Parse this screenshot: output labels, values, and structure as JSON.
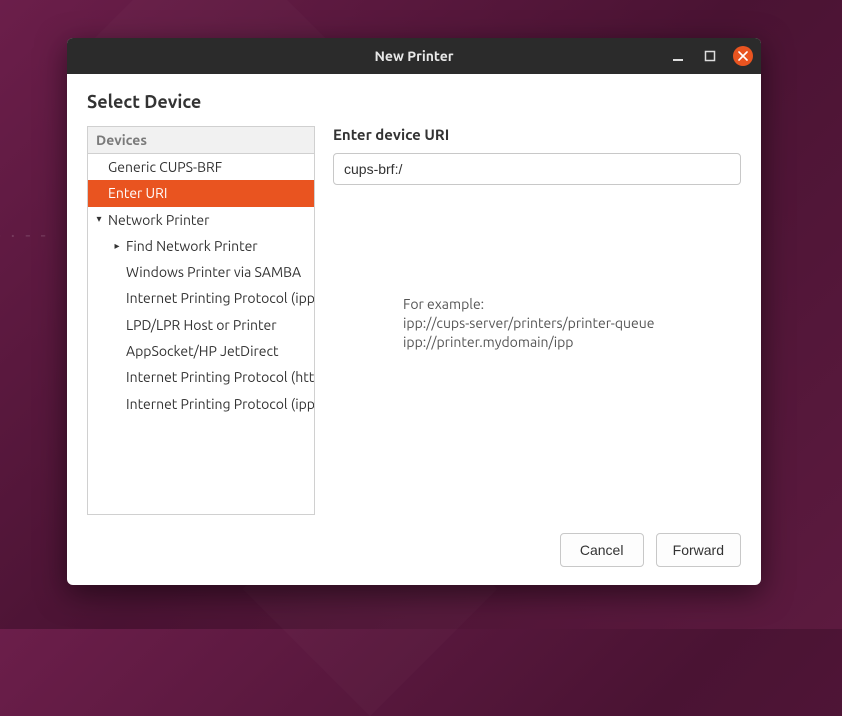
{
  "titlebar": {
    "title": "New Printer"
  },
  "page": {
    "heading": "Select Device"
  },
  "devices": {
    "header": "Devices",
    "items": [
      {
        "label": "Generic CUPS-BRF",
        "level": 0,
        "expandable": false,
        "selected": false
      },
      {
        "label": "Enter URI",
        "level": 0,
        "expandable": false,
        "selected": true
      },
      {
        "label": "Network Printer",
        "level": 0,
        "expandable": true,
        "expanded": true,
        "selected": false
      },
      {
        "label": "Find Network Printer",
        "level": 1,
        "expandable": true,
        "expanded": false,
        "selected": false
      },
      {
        "label": "Windows Printer via SAMBA",
        "level": 1,
        "expandable": false,
        "selected": false
      },
      {
        "label": "Internet Printing Protocol (ipp)",
        "level": 1,
        "expandable": false,
        "selected": false
      },
      {
        "label": "LPD/LPR Host or Printer",
        "level": 1,
        "expandable": false,
        "selected": false
      },
      {
        "label": "AppSocket/HP JetDirect",
        "level": 1,
        "expandable": false,
        "selected": false
      },
      {
        "label": "Internet Printing Protocol (https)",
        "level": 1,
        "expandable": false,
        "selected": false
      },
      {
        "label": "Internet Printing Protocol (ipps)",
        "level": 1,
        "expandable": false,
        "selected": false
      }
    ]
  },
  "uri": {
    "label": "Enter device URI",
    "value": "cups-brf:/",
    "example_intro": "For example:",
    "example1": "ipp://cups-server/printers/printer-queue",
    "example2": "ipp://printer.mydomain/ipp"
  },
  "buttons": {
    "cancel": "Cancel",
    "forward": "Forward"
  }
}
